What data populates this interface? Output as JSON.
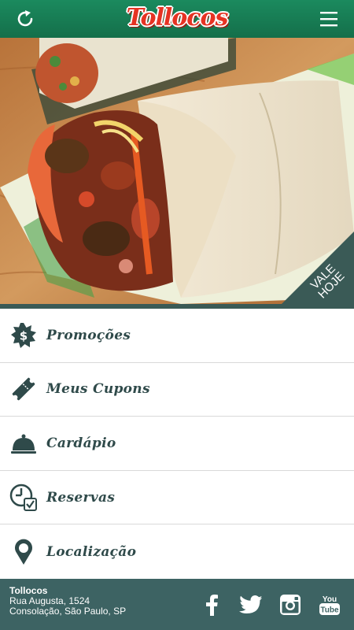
{
  "header": {
    "logo_text": "Tollocos",
    "refresh_icon": "refresh-icon",
    "menu_icon": "hamburger-menu-icon"
  },
  "hero": {
    "ribbon_line1": "VALE",
    "ribbon_line2": "HOJE"
  },
  "menu": {
    "items": [
      {
        "label": "Promoções",
        "icon": "dollar-badge-icon"
      },
      {
        "label": "Meus Cupons",
        "icon": "ticket-icon"
      },
      {
        "label": "Cardápio",
        "icon": "food-cloche-icon"
      },
      {
        "label": "Reservas",
        "icon": "clock-check-icon"
      },
      {
        "label": "Localização",
        "icon": "map-pin-icon"
      }
    ]
  },
  "footer": {
    "name": "Tollocos",
    "street": "Rua Augusta, 1524",
    "city": "Consolação, São Paulo, SP",
    "social": [
      "facebook-icon",
      "twitter-icon",
      "instagram-icon",
      "youtube-icon"
    ],
    "youtube_text": "You Tube"
  },
  "colors": {
    "header_green": "#1b8a5e",
    "logo_red": "#e63323",
    "teal": "#3a5a56",
    "footer_teal": "#3d6363",
    "label_text": "#2f4a4a"
  }
}
